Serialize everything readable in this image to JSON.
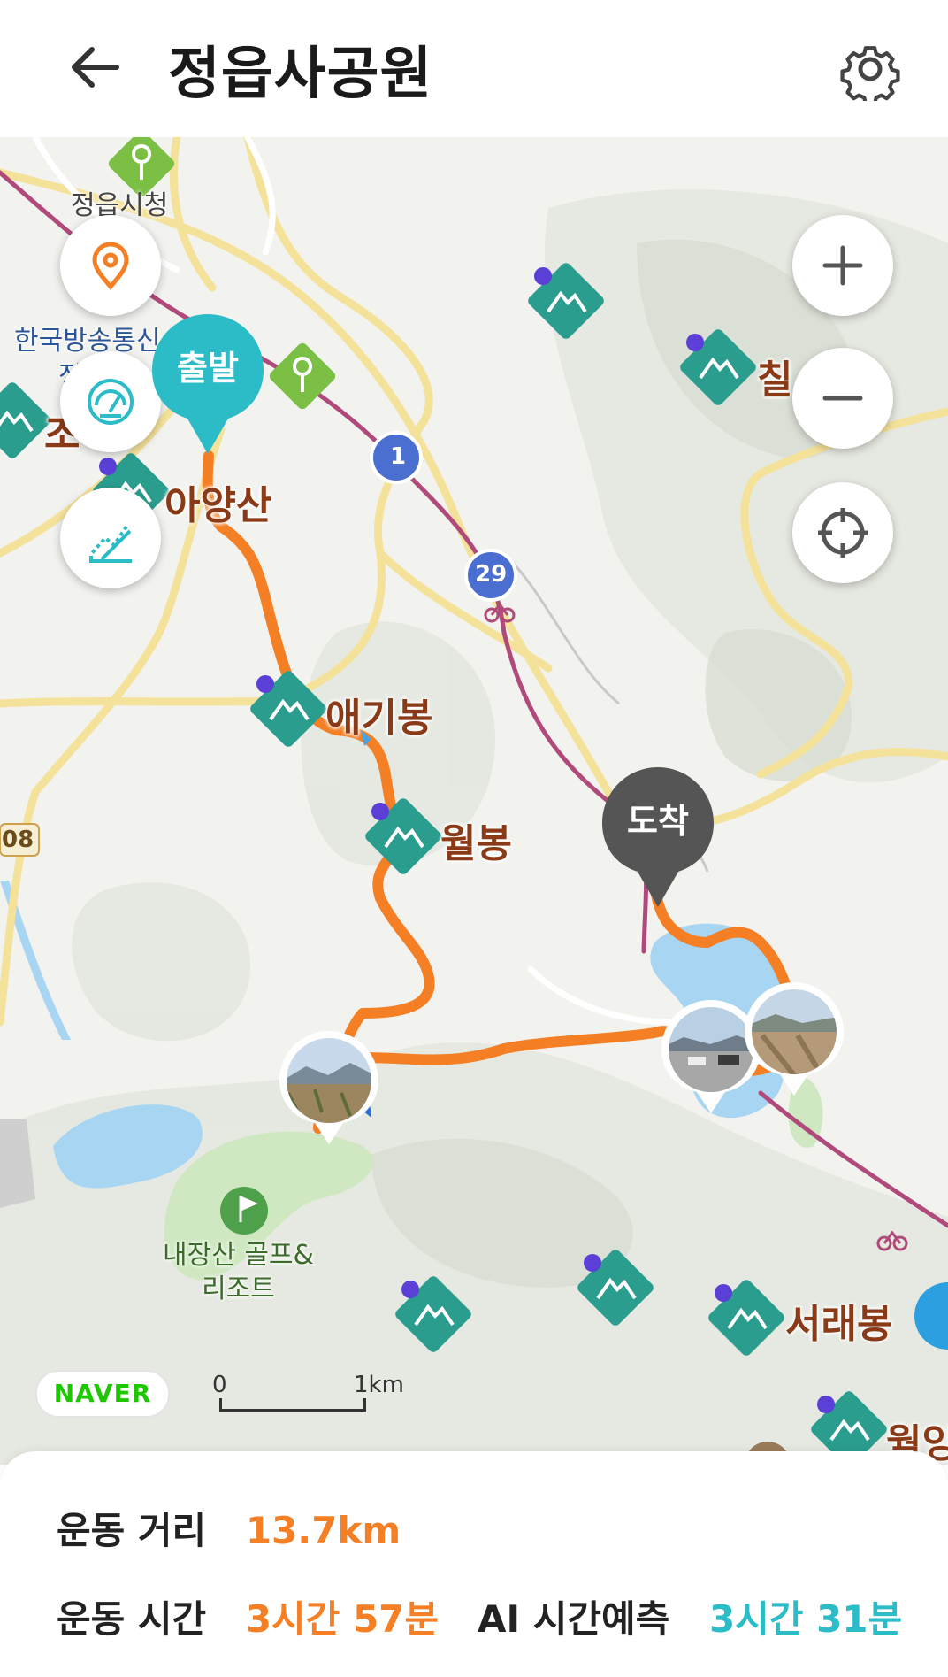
{
  "header": {
    "title": "정읍사공원",
    "back_icon": "arrow-left-icon",
    "settings_icon": "gear-icon"
  },
  "map": {
    "labels": {
      "city_hall": "정읍시청",
      "broadcast": "한국방송통신",
      "broadcast2": "정",
      "peak_left": "조",
      "peak_ayangsan": "아양산",
      "peak_aegibong": "애기봉",
      "peak_wolbong": "월봉",
      "peak_chil": "칠",
      "peak_seoraebong": "서래봉",
      "peak_wol2": "월잉",
      "golf": "내장산 골프&",
      "golf2": "리조트",
      "road_08": "08",
      "road_1": "1",
      "road_29": "29"
    },
    "markers": {
      "start": "출발",
      "end": "도착"
    },
    "controls": {
      "zoom_in": "+",
      "zoom_out": "−"
    },
    "naver": "NAVER",
    "scale_zero": "0",
    "scale_km": "1km"
  },
  "stats": {
    "distance_label": "운동 거리",
    "distance_value": "13.7km",
    "time_label": "운동 시간",
    "time_value": "3시간 57분",
    "ai_label": "AI 시간예측",
    "ai_value": "3시간 31분"
  },
  "colors": {
    "route": "#f47f25",
    "start_pin": "#2bbcc7",
    "end_pin": "#555555",
    "mountain_icon": "#2a9d8f"
  }
}
